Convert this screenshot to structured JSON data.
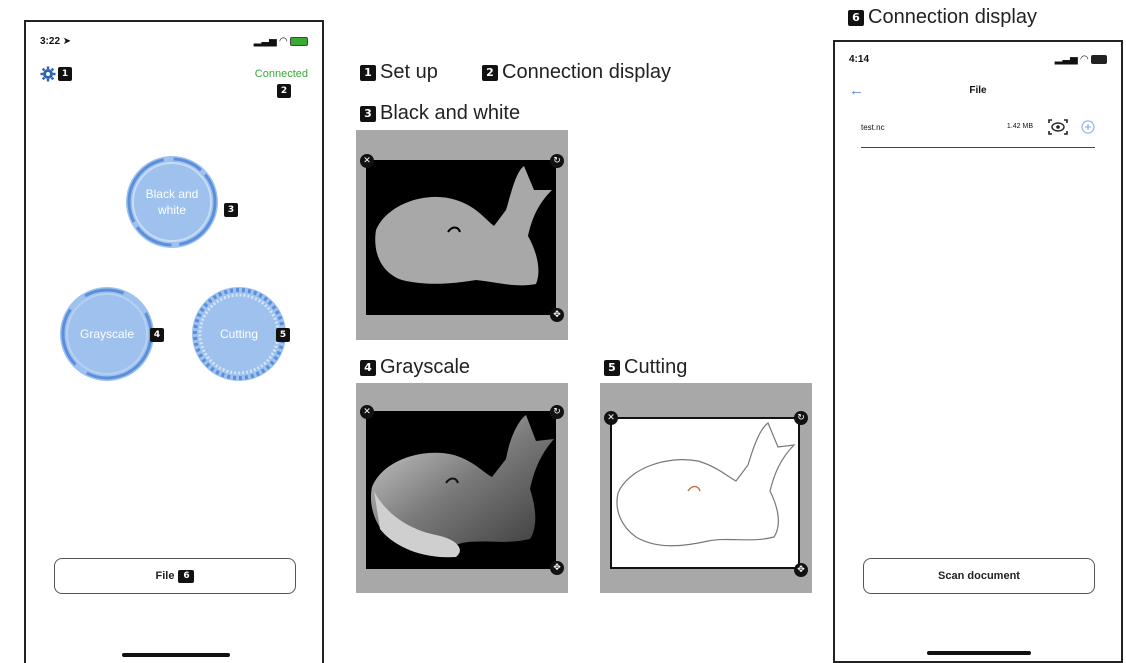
{
  "left_phone": {
    "time": "3:22",
    "status_text": "Connected",
    "labels": {
      "setup": "1",
      "connection": "2",
      "bw": "3",
      "grayscale": "4",
      "cutting": "5",
      "file": "6"
    },
    "modes": {
      "bw": "Black and white",
      "grayscale": "Grayscale",
      "cutting": "Cutting"
    },
    "file_button": "File"
  },
  "legend": {
    "setup": {
      "num": "1",
      "text": "Set up"
    },
    "connection": {
      "num": "2",
      "text": "Connection display"
    },
    "bw": {
      "num": "3",
      "text": "Black and white"
    },
    "grayscale": {
      "num": "4",
      "text": "Grayscale"
    },
    "cutting": {
      "num": "5",
      "text": "Cutting"
    },
    "file_display": {
      "num": "6",
      "text": "Connection display"
    }
  },
  "right_phone": {
    "time": "4:14",
    "title": "File",
    "file_name": "test.nc",
    "file_size": "1.42 MB",
    "scan_button": "Scan document"
  },
  "colors": {
    "accent": "#5b8fdc",
    "mode_fill": "#9ec1ee",
    "connected": "#3aaa35"
  }
}
